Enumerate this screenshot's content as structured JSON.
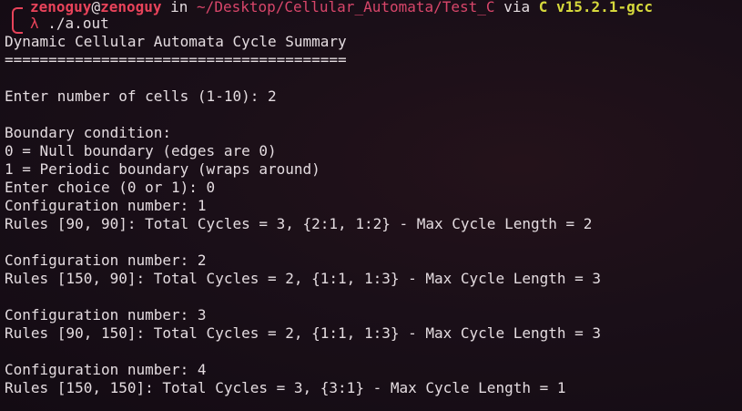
{
  "prompt": {
    "user": "zenoguy",
    "at": "@",
    "host": "zenoguy",
    "in": " in ",
    "path": "~/Desktop/Cellular_Automata/Test_C",
    "via": " via ",
    "lang_icon": "C",
    "version": "v15.2.1-gcc",
    "lambda": "λ",
    "command": "./a.out"
  },
  "output_lines": [
    "Dynamic Cellular Automata Cycle Summary",
    "=======================================",
    "",
    "Enter number of cells (1-10): 2",
    "",
    "Boundary condition:",
    "0 = Null boundary (edges are 0)",
    "1 = Periodic boundary (wraps around)",
    "Enter choice (0 or 1): 0",
    "Configuration number: 1",
    "Rules [90, 90]: Total Cycles = 3, {2:1, 1:2} - Max Cycle Length = 2",
    "",
    "Configuration number: 2",
    "Rules [150, 90]: Total Cycles = 2, {1:1, 1:3} - Max Cycle Length = 3",
    "",
    "Configuration number: 3",
    "Rules [90, 150]: Total Cycles = 2, {1:1, 1:3} - Max Cycle Length = 3",
    "",
    "Configuration number: 4",
    "Rules [150, 150]: Total Cycles = 3, {3:1} - Max Cycle Length = 1"
  ],
  "colors": {
    "background": "#1a0f18",
    "text": "#e4dce0",
    "accent_red": "#e8435a",
    "path_pink": "#d8466a",
    "lang_yellow": "#d6d93c"
  }
}
